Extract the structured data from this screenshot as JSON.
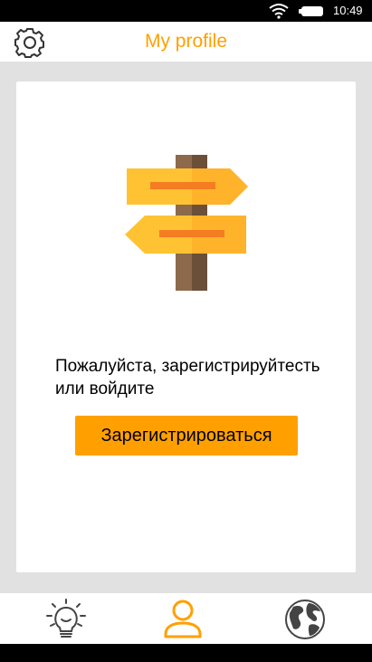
{
  "status_bar": {
    "time": "10:49",
    "icons": [
      "wifi-icon",
      "battery-icon"
    ]
  },
  "app_bar": {
    "title": "My profile",
    "settings_icon": "gear-icon"
  },
  "card": {
    "illustration": "signpost-icon",
    "prompt_line1": "Пожалуйста, зарегистрируйтесть",
    "prompt_line2": "или войдите",
    "register_label": "Зарегистрироваться"
  },
  "bottom_nav": {
    "items": [
      {
        "icon": "lightbulb-icon",
        "active": false
      },
      {
        "icon": "person-icon",
        "active": true
      },
      {
        "icon": "globe-icon",
        "active": false
      }
    ]
  },
  "colors": {
    "accent": "#ffa000",
    "inactive_icon": "#444444",
    "background": "#e1e1e1"
  }
}
